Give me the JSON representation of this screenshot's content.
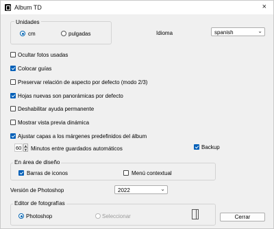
{
  "window": {
    "title": "Album TD",
    "close_icon": "×"
  },
  "units": {
    "group_label": "Unidades",
    "options": [
      {
        "label": "cm",
        "selected": true
      },
      {
        "label": "pulgadas",
        "selected": false
      }
    ]
  },
  "language": {
    "label": "Idioma",
    "value": "spanish"
  },
  "checkboxes": [
    {
      "label": "Ocultar fotos usadas",
      "checked": false
    },
    {
      "label": "Colocar guías",
      "checked": true
    },
    {
      "label": "Preservar relación de aspecto por defecto (modo 2/3)",
      "checked": false
    },
    {
      "label": "Hojas nuevas son panorámicas por defecto",
      "checked": true
    },
    {
      "label": "Deshabilitar ayuda permanente",
      "checked": false
    },
    {
      "label": "Mostrar vista previa dinámica",
      "checked": false
    },
    {
      "label": "Ajustar capas a los márgenes predefinidos del álbum",
      "checked": true
    }
  ],
  "autosave": {
    "minutes": "60",
    "label": "Minutos entre guardados automáticos"
  },
  "backup": {
    "label": "Backup",
    "checked": true
  },
  "design_area": {
    "group_label": "En área de diseño",
    "icon_bars": {
      "label": "Barras de iconos",
      "checked": true
    },
    "context_menu": {
      "label": "Menú contextual",
      "checked": false
    }
  },
  "photoshop_version": {
    "label": "Versión de Photoshop",
    "value": "2022"
  },
  "photo_editor": {
    "group_label": "Editor de fotografías",
    "options": [
      {
        "label": "Photoshop",
        "selected": true
      },
      {
        "label": "Seleccionar",
        "selected": false
      }
    ]
  },
  "buttons": {
    "close": "Cerrar"
  }
}
